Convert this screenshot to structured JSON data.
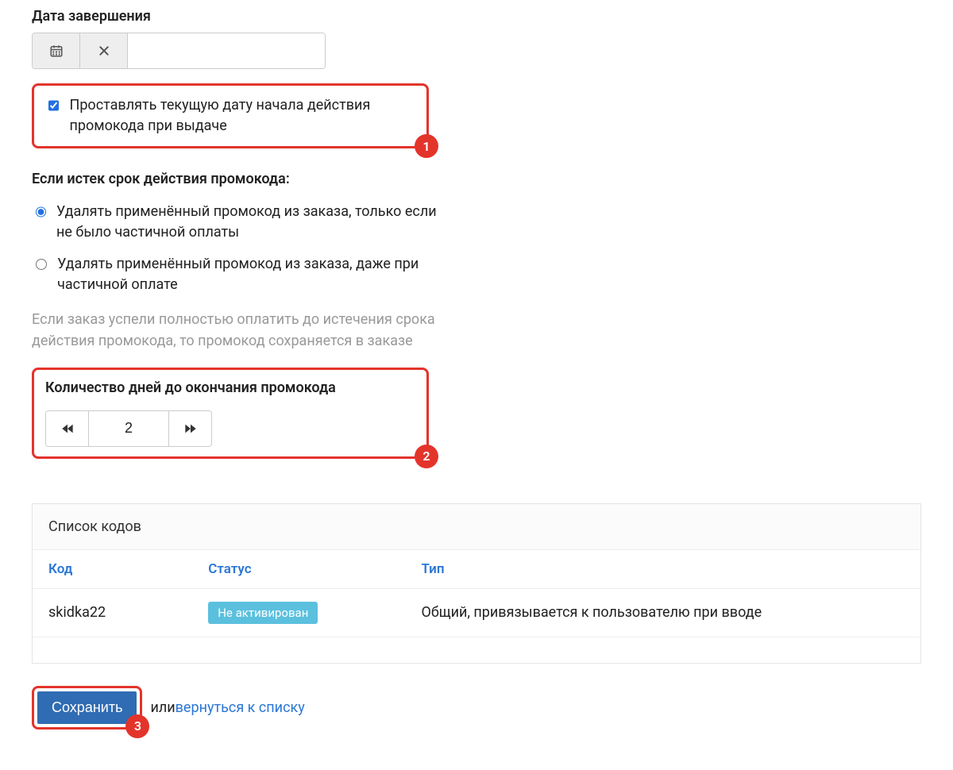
{
  "end_date": {
    "label": "Дата завершения",
    "value": ""
  },
  "set_current_date": {
    "label": "Проставлять текущую дату начала действия промокода при выдаче",
    "checked": true,
    "badge": "1"
  },
  "expired_section": {
    "title": "Если истек срок действия промокода:",
    "options": [
      {
        "label": "Удалять применённый промокод из заказа, только если не было частичной оплаты",
        "checked": true
      },
      {
        "label": "Удалять применённый промокод из заказа, даже при частичной оплате",
        "checked": false
      }
    ],
    "hint": "Если заказ успели полностью оплатить до истечения срока действия промокода, то промокод сохраняется в заказе"
  },
  "days_until": {
    "label": "Количество дней до окончания промокода",
    "value": "2",
    "badge": "2"
  },
  "codes_panel": {
    "title": "Список кодов",
    "columns": {
      "code": "Код",
      "status": "Статус",
      "type": "Тип"
    },
    "rows": [
      {
        "code": "skidka22",
        "status": "Не активирован",
        "type": "Общий, привязывается к пользователю при вводе"
      }
    ]
  },
  "actions": {
    "save": "Сохранить",
    "or": " или ",
    "return": "вернуться к списку",
    "badge": "3"
  }
}
